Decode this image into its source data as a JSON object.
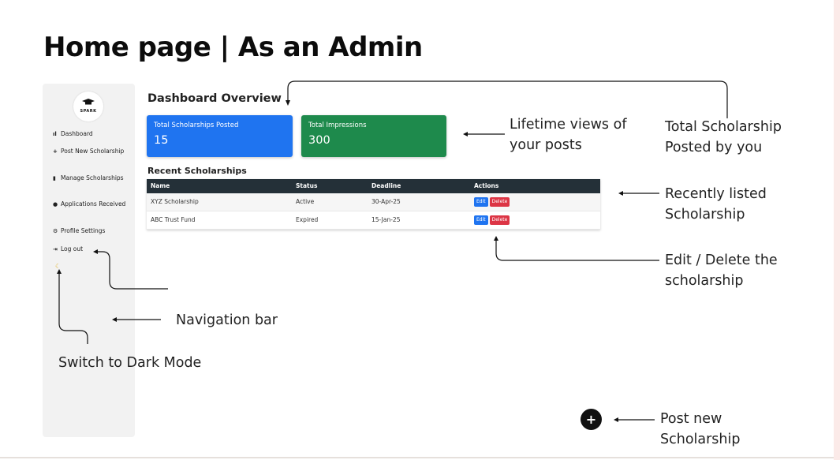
{
  "slide_title": "Home page | As an Admin",
  "sidebar": {
    "logo_text": "SPARK",
    "items": [
      {
        "icon": "bar-chart-icon",
        "label": "Dashboard"
      },
      {
        "icon": "plus-icon",
        "label": "Post New Scholarship"
      },
      {
        "icon": "file-icon",
        "label": "Manage Scholarships"
      },
      {
        "icon": "info-icon",
        "label": "Applications Received"
      },
      {
        "icon": "gear-icon",
        "label": "Profile Settings"
      },
      {
        "icon": "logout-icon",
        "label": "Log out"
      }
    ],
    "dark_mode_icon": "moon-icon"
  },
  "dashboard": {
    "title": "Dashboard Overview",
    "cards": [
      {
        "label": "Total Scholarships Posted",
        "value": "15",
        "color": "#1f74f0"
      },
      {
        "label": "Total Impressions",
        "value": "300",
        "color": "#1e8a4c"
      }
    ],
    "recent_title": "Recent Scholarships",
    "table": {
      "headers": [
        "Name",
        "Status",
        "Deadline",
        "Actions"
      ],
      "rows": [
        {
          "name": "XYZ Scholarship",
          "status": "Active",
          "deadline": "30-Apr-25"
        },
        {
          "name": "ABC Trust Fund",
          "status": "Expired",
          "deadline": "15-Jan-25"
        }
      ],
      "edit_label": "Edit",
      "delete_label": "Delete"
    }
  },
  "fab": {
    "label": "+"
  },
  "annotations": {
    "lifetime_views": [
      "Lifetime views of",
      "your posts"
    ],
    "total_scholarship": [
      "Total Scholarship",
      "Posted by you"
    ],
    "recently_listed": [
      "Recently listed",
      "Scholarship"
    ],
    "edit_delete": [
      "Edit / Delete the",
      "scholarship"
    ],
    "navigation_bar": "Navigation bar",
    "dark_mode": "Switch to Dark Mode",
    "post_new": [
      "Post new",
      "Scholarship"
    ]
  }
}
